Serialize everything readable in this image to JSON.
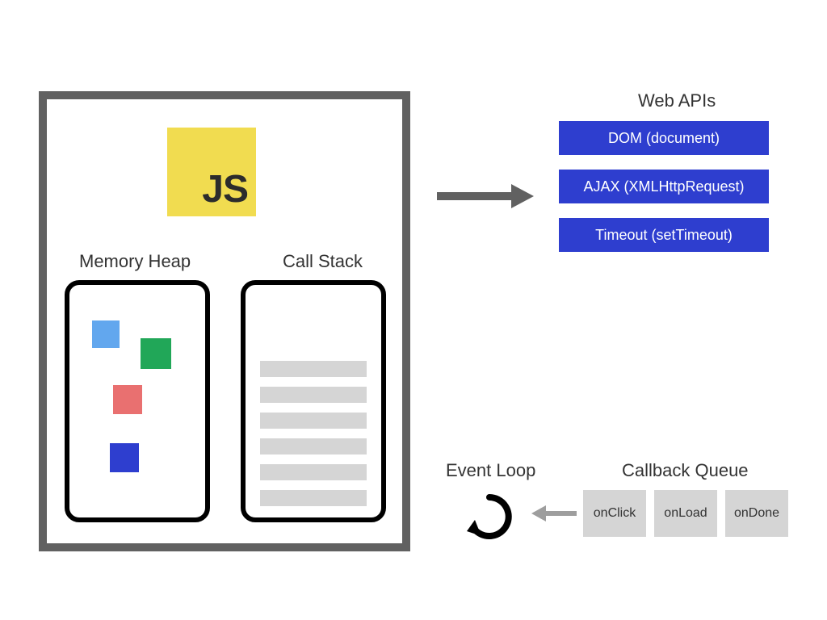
{
  "logo": {
    "text": "JS"
  },
  "engine": {
    "memory_heap_label": "Memory Heap",
    "call_stack_label": "Call Stack"
  },
  "web_apis": {
    "title": "Web APIs",
    "items": [
      {
        "label": "DOM (document)"
      },
      {
        "label": "AJAX (XMLHttpRequest)"
      },
      {
        "label": "Timeout (setTimeout)"
      }
    ]
  },
  "event_loop": {
    "label": "Event Loop"
  },
  "callback_queue": {
    "title": "Callback Queue",
    "items": [
      {
        "label": "onClick"
      },
      {
        "label": "onLoad"
      },
      {
        "label": "onDone"
      }
    ]
  }
}
